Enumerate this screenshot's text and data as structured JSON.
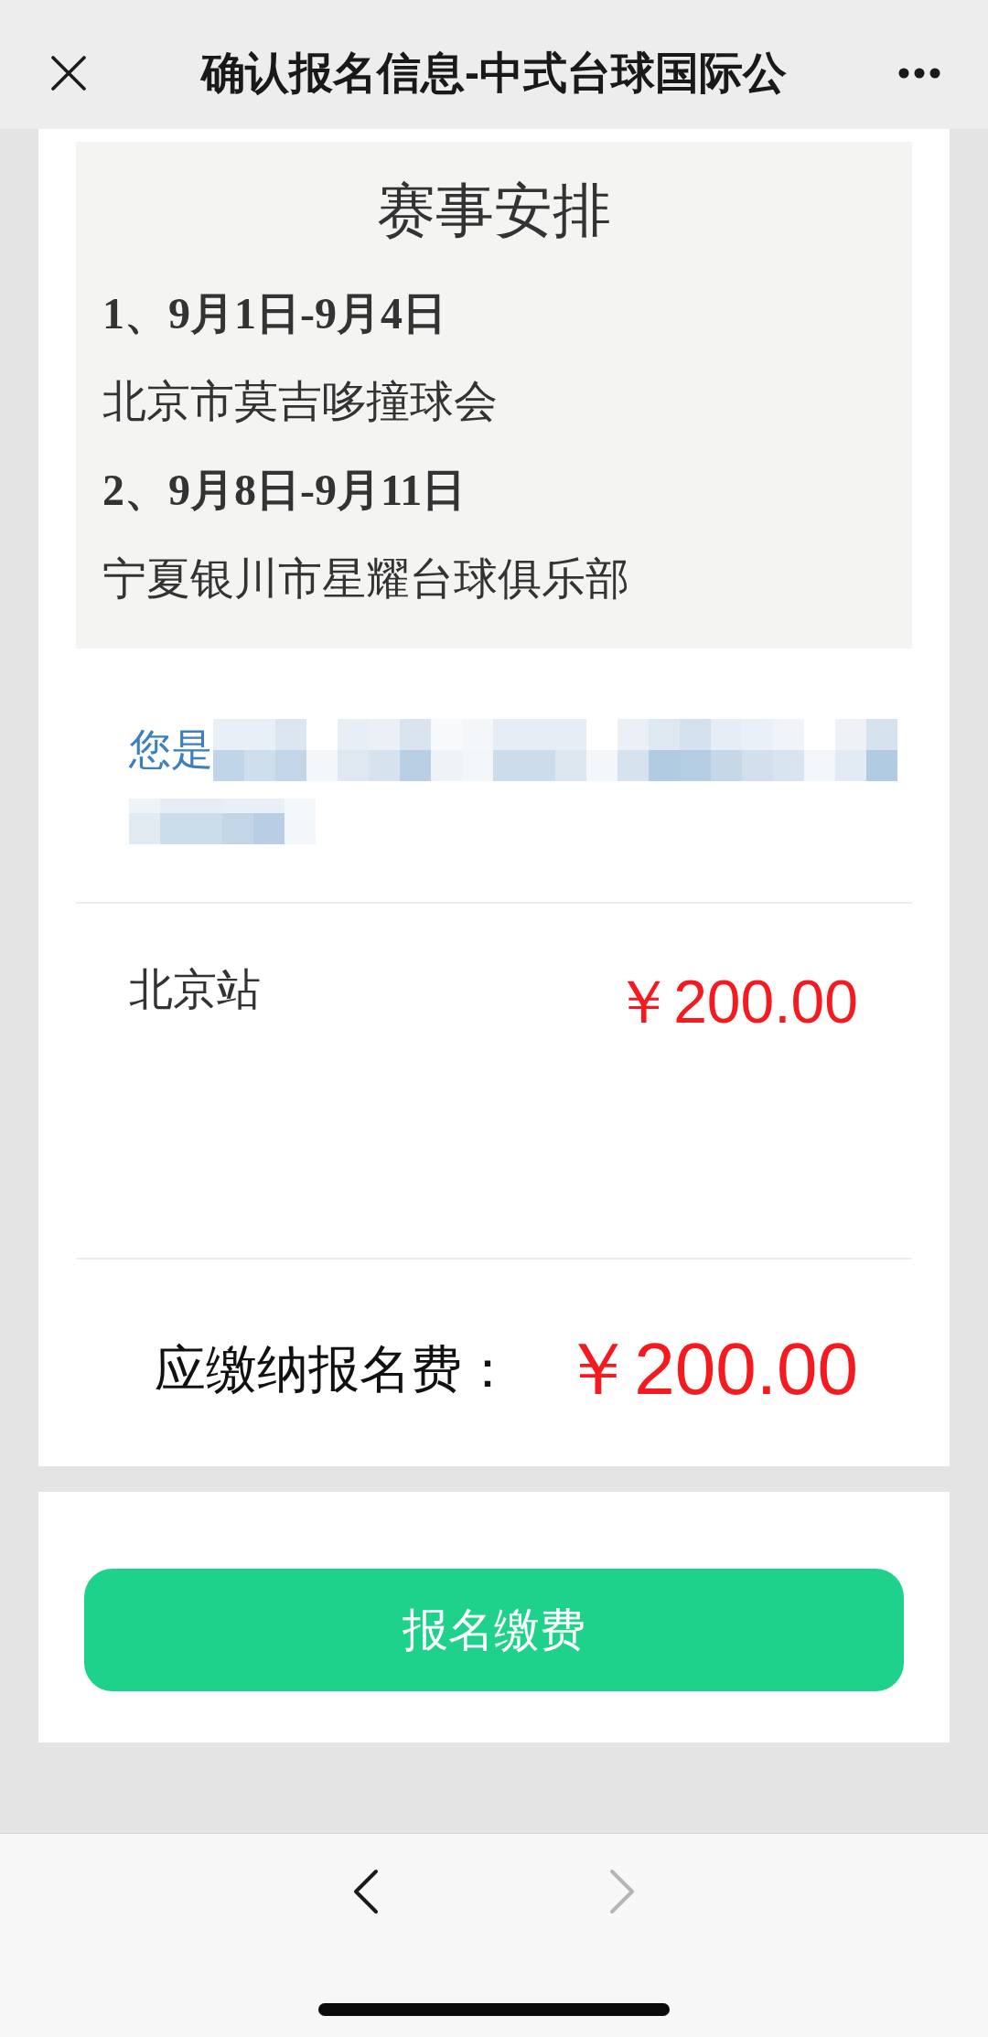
{
  "header": {
    "title": "确认报名信息-中式台球国际公"
  },
  "schedule": {
    "title": "赛事安排",
    "items": [
      {
        "kind": "date",
        "text": "1、9月1日-9月4日"
      },
      {
        "kind": "venue",
        "text": "北京市莫吉哆撞球会"
      },
      {
        "kind": "date",
        "text": "2、9月8日-9月11日"
      },
      {
        "kind": "venue",
        "text": "宁夏银川市星耀台球俱乐部"
      }
    ]
  },
  "user_notice": {
    "text": "您是"
  },
  "stations": [
    {
      "name": "北京站",
      "price": "￥200.00"
    }
  ],
  "total": {
    "label": "应缴纳报名费：",
    "amount": "￥200.00"
  },
  "pay_button": {
    "label": "报名缴费"
  },
  "bottom_bar": {
    "back": {
      "disabled": false
    },
    "forward": {
      "disabled": true
    }
  }
}
